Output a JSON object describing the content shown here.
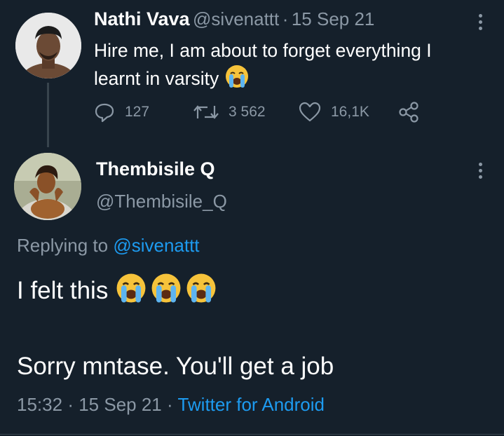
{
  "tweet": {
    "author_name": "Nathi Vava",
    "author_handle": "@sivenattt",
    "separator": "·",
    "date": "15 Sep 21",
    "text_line1": "Hire me, I am about to forget everything I",
    "text_line2": "learnt in varsity",
    "emoji": "loudly-crying-face",
    "replies": "127",
    "retweets": "3 562",
    "likes": "16,1K"
  },
  "reply": {
    "author_name": "Thembisile Q",
    "author_handle": "@Thembisile_Q",
    "replying_prefix": "Replying to",
    "replying_handle": "@sivenattt",
    "text_line1": "I felt this",
    "emoji": "loudly-crying-face",
    "emoji_count": 3,
    "text_line2": "Sorry mntase. You'll get a job",
    "time": "15:32",
    "separator": "·",
    "date": "15 Sep 21",
    "separator2": "·",
    "source": "Twitter for Android"
  },
  "colors": {
    "background": "#15202b",
    "muted": "#8b98a5",
    "link": "#1d9bf0",
    "thread_line": "#38444d"
  }
}
